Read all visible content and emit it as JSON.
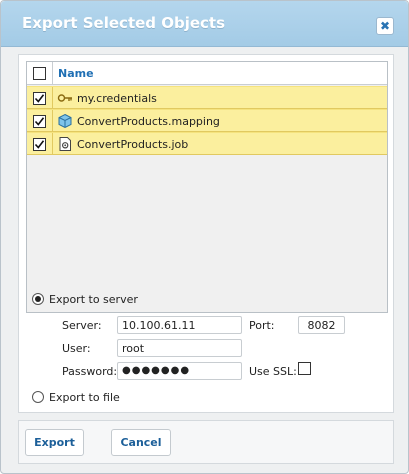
{
  "dialog": {
    "title": "Export Selected Objects",
    "close_glyph": "✖"
  },
  "grid": {
    "header": {
      "name_label": "Name",
      "select_all_checked": false
    },
    "rows": [
      {
        "label": "my.credentials",
        "icon": "key-icon",
        "checked": true
      },
      {
        "label": "ConvertProducts.mapping",
        "icon": "mapping-cube-icon",
        "checked": true
      },
      {
        "label": "ConvertProducts.job",
        "icon": "job-gear-icon",
        "checked": true
      }
    ],
    "row_highlight_color": "#fbef9e"
  },
  "export_options": {
    "server_label": "Export to server",
    "server_selected": true,
    "file_label": "Export to file",
    "file_selected": false
  },
  "server": {
    "server_label": "Server:",
    "server_value": "10.100.61.11",
    "port_label": "Port:",
    "port_value": "8082",
    "user_label": "User:",
    "user_value": "root",
    "password_label": "Password:",
    "password_value": "●●●●●●●",
    "ssl_label": "Use SSL:",
    "ssl_checked": false
  },
  "footer": {
    "export_label": "Export",
    "cancel_label": "Cancel"
  },
  "colors": {
    "title_bar": "#a9cfe8",
    "link_blue": "#1f6fb4"
  }
}
